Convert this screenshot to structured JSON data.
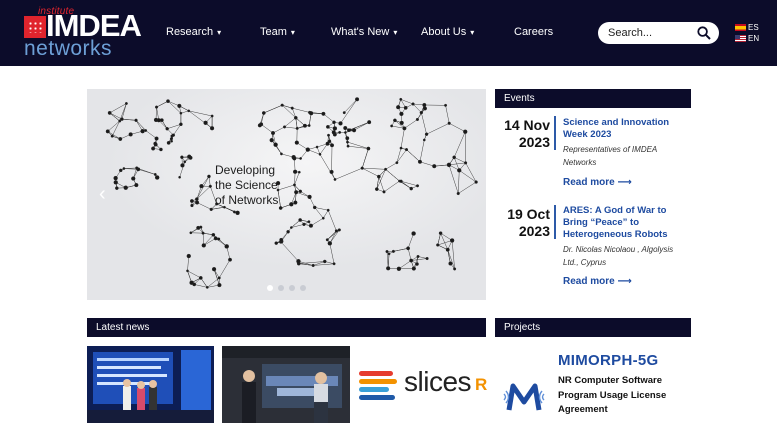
{
  "header": {
    "logo": {
      "institute": "institute",
      "imdea": "IMDEA",
      "networks": "networks"
    },
    "nav": [
      {
        "label": "Research",
        "caret": "▾"
      },
      {
        "label": "Team",
        "caret": "▾"
      },
      {
        "label": "What's New",
        "caret": "▾"
      },
      {
        "label": "About Us",
        "caret": "▾"
      },
      {
        "label": "Careers",
        "caret": ""
      }
    ],
    "search": {
      "placeholder": "Search..."
    },
    "languages": [
      {
        "code": "ES"
      },
      {
        "code": "EN"
      }
    ]
  },
  "hero": {
    "caption_lines": [
      "Developing",
      "the Science",
      "of Networks"
    ],
    "prev_arrow": "‹",
    "slide_count": 4,
    "active_slide": 1
  },
  "events": {
    "header": "Events",
    "items": [
      {
        "date_day": "14 Nov",
        "date_year": "2023",
        "title": "Science and Innovation Week 2023",
        "description": "Representatives of IMDEA Networks",
        "more": "Read more ⟶"
      },
      {
        "date_day": "19 Oct",
        "date_year": "2023",
        "title": "ARES: A God of War to Bring “Peace” to Heterogeneous Robots",
        "description": "Dr. Nicolas Nicolaou , Algolysis Ltd., Cyprus",
        "more": "Read more ⟶"
      }
    ]
  },
  "news": {
    "header": "Latest news",
    "slices_logo": {
      "word": "slices",
      "suffix": "R"
    }
  },
  "projects": {
    "header": "Projects",
    "name": "MIMORPH-5G",
    "description": "NR Computer Software Program Usage License Agreement"
  },
  "colors": {
    "navy": "#0c0c2a",
    "link_blue": "#1e4ba0",
    "brand_red": "#e0242d",
    "brand_lightblue": "#6d9fd6"
  }
}
